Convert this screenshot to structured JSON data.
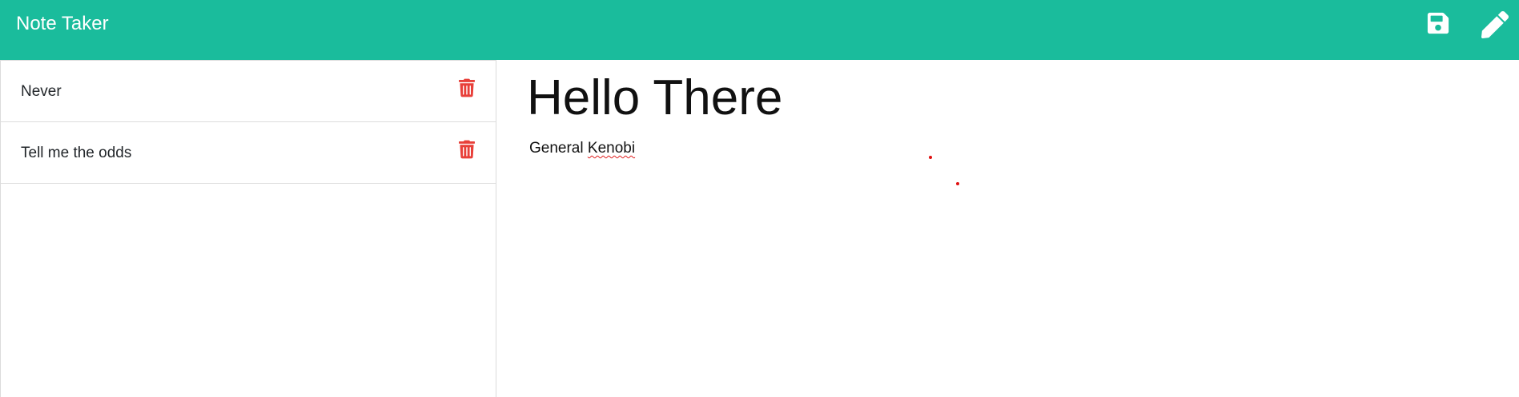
{
  "app": {
    "title": "Note Taker",
    "brand_color": "#1abc9c"
  },
  "toolbar": {
    "save_icon": "save-icon",
    "edit_icon": "pencil-icon",
    "icon_color": "#ffffff"
  },
  "sidebar": {
    "notes": [
      {
        "title": "Never",
        "delete_icon": "trash-icon"
      },
      {
        "title": "Tell me the odds",
        "delete_icon": "trash-icon"
      }
    ],
    "delete_color": "#e8403a"
  },
  "editor": {
    "title": "Hello There",
    "body_word1": "General",
    "body_word2": "Kenobi",
    "spellcheck_color": "#e02020"
  }
}
